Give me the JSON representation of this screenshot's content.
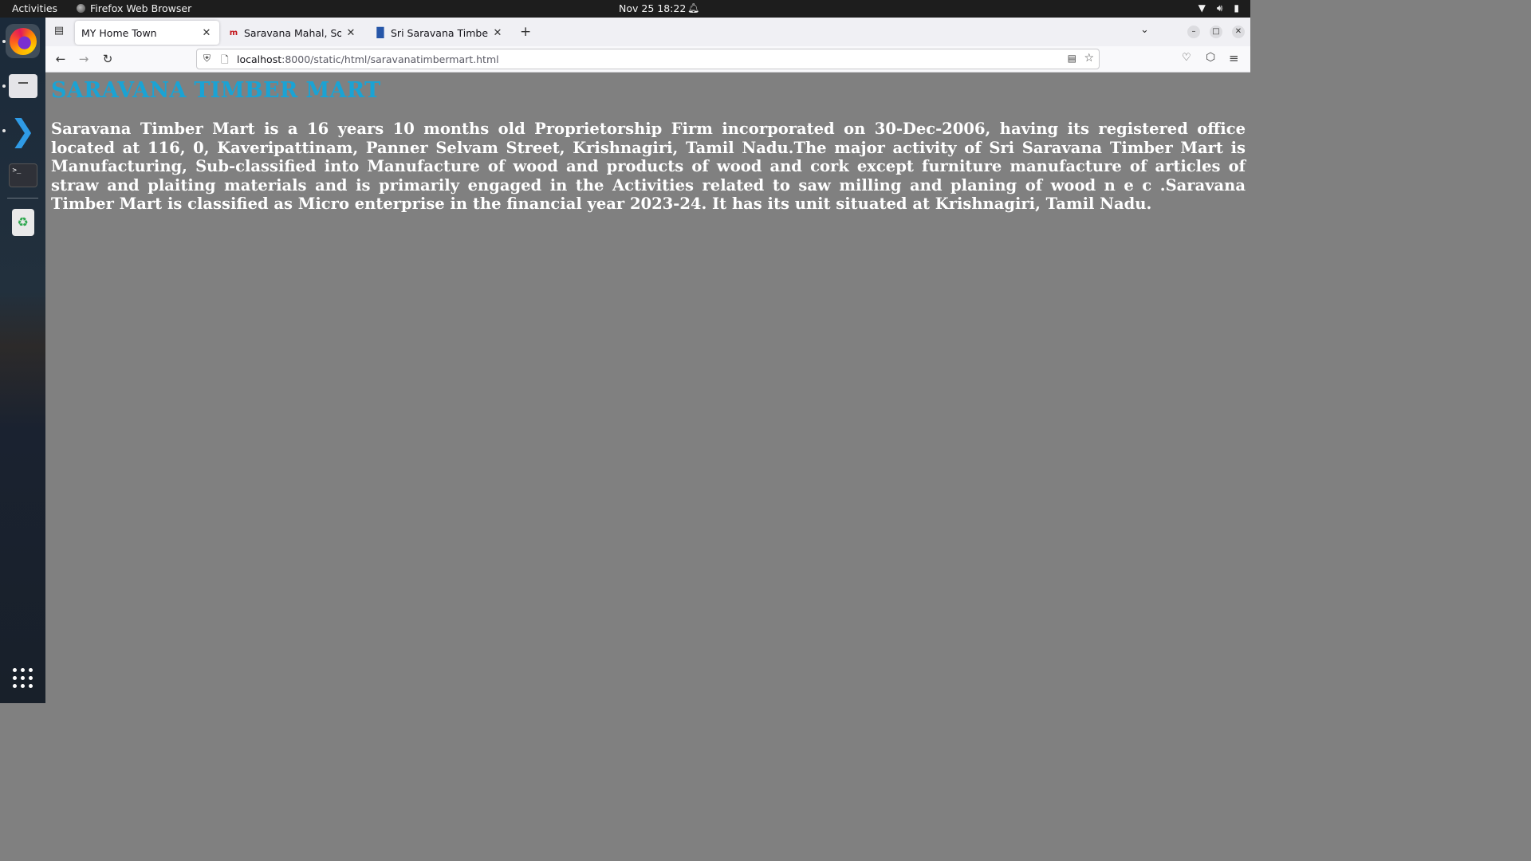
{
  "topbar": {
    "activities": "Activities",
    "app_name": "Firefox Web Browser",
    "clock": "Nov 25  18:22"
  },
  "dock": {
    "apps": [
      "firefox",
      "files",
      "vscode",
      "terminal",
      "trash"
    ]
  },
  "browser": {
    "tabs": [
      {
        "label": "MY Home Town",
        "active": true
      },
      {
        "label": "Saravana Mahal, Solar, Er",
        "favicon": "m"
      },
      {
        "label": "Sri Saravana Timber Mart",
        "favicon": "chart"
      }
    ],
    "url": {
      "host": "localhost",
      "path": ":8000/static/html/saravanatimbermart.html"
    }
  },
  "page": {
    "heading": "SARAVANA TIMBER MART",
    "paragraph": "Saravana Timber Mart is a 16 years 10 months old Proprietorship Firm incorporated on 30-Dec-2006, having its registered office located at 116, 0, Kaveripattinam, Panner Selvam Street, Krishnagiri, Tamil Nadu.The major activity of Sri Saravana Timber Mart is Manufacturing, Sub-classified into Manufacture of wood and products of wood and cork except furniture manufacture of articles of straw and plaiting materials and is primarily engaged in the Activities related to saw milling and planing of wood n e c .Saravana Timber Mart is classified as Micro enterprise in the financial year 2023-24. It has its unit situated at Krishnagiri, Tamil Nadu."
  },
  "colors": {
    "page_background": "#808080",
    "heading": "#1aa3d4",
    "paragraph": "#ffffff"
  }
}
